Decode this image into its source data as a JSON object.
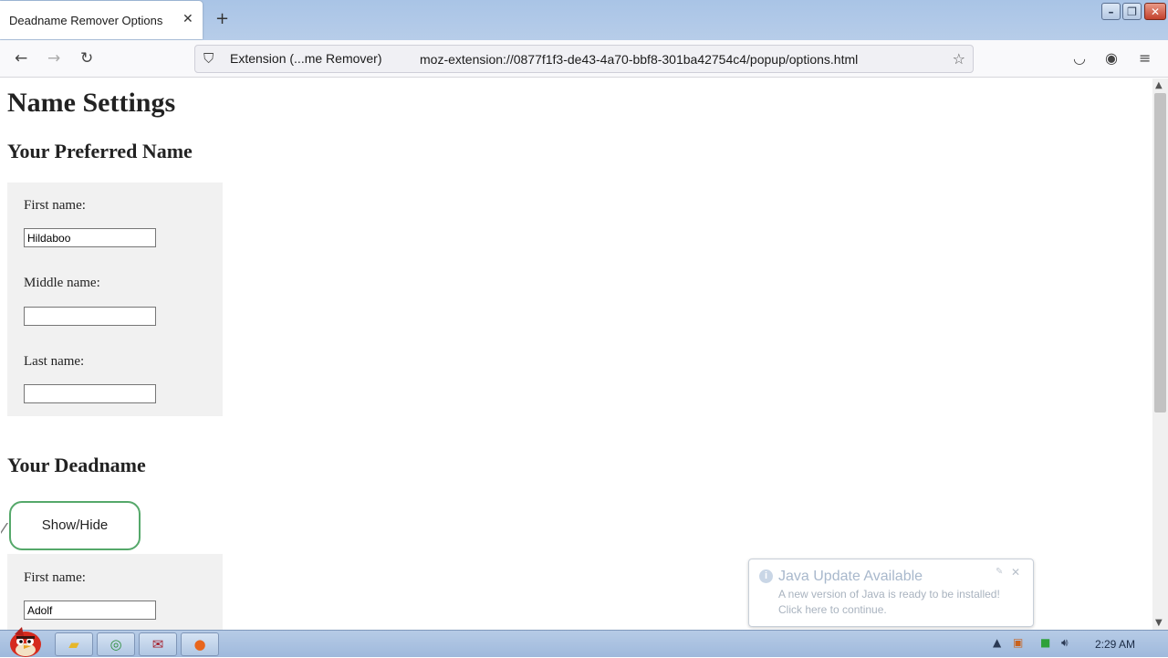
{
  "browser": {
    "tab_title": "Deadname Remover Options",
    "tab_close": "✕",
    "new_tab": "+",
    "url_identity": "Extension (...me Remover)",
    "url": "moz-extension://0877f1f3-de43-4a70-bbf8-301ba42754c4/popup/options.html",
    "window_controls": {
      "minimize": "–",
      "maximize": "❐",
      "close": "✕"
    },
    "icons": [
      "back-arrow-icon",
      "forward-arrow-icon",
      "reload-icon",
      "shield-icon",
      "puzzle-icon",
      "star-icon",
      "pocket-icon",
      "account-icon",
      "menu-icon"
    ]
  },
  "page": {
    "title": "Name Settings",
    "preferred": {
      "heading": "Your Preferred Name",
      "first_label": "First name:",
      "first_value": "Hildaboo",
      "middle_label": "Middle name:",
      "middle_value": "",
      "last_label": "Last name:",
      "last_value": ""
    },
    "deadname": {
      "heading": "Your Deadname",
      "toggle_label": "Show/Hide",
      "first_label": "First name:",
      "first_value": "Adolf"
    }
  },
  "notification": {
    "title": "Java Update Available",
    "line1": "A new version of Java is ready to be installed!",
    "line2": "Click here to continue."
  },
  "taskbar": {
    "clock": "2:29 AM",
    "apps": [
      "start-orb",
      "explorer",
      "chrome",
      "mail",
      "firefox"
    ]
  }
}
